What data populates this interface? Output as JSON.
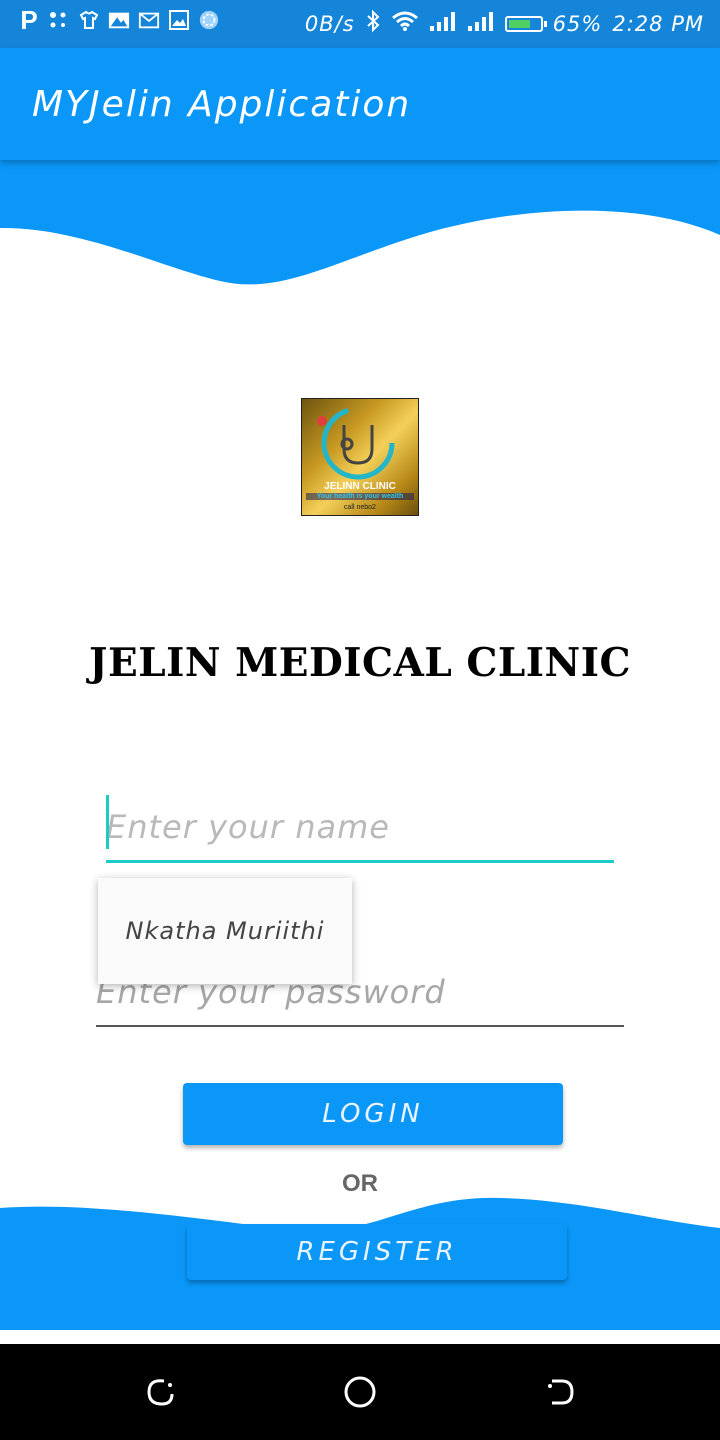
{
  "status_bar": {
    "left_icons": [
      "p-icon",
      "dots-icon",
      "tshirt-icon",
      "image-icon",
      "gmail-icon",
      "gallery-icon",
      "sync-icon"
    ],
    "net_speed": "0B/s",
    "battery_percent": "65%",
    "battery_level": 0.65,
    "time": "2:28 PM"
  },
  "app_bar": {
    "title": "MYJelin Application"
  },
  "colors": {
    "primary": "#0b97f8",
    "status_bar": "#1485d8",
    "accent": "#1ccbc6"
  },
  "logo": {
    "name": "JELINN CLINIC",
    "tagline": "Your health is your wealth",
    "call": "call nebo2"
  },
  "heading": "JELIN MEDICAL CLINIC",
  "form": {
    "name_placeholder": "Enter your name",
    "name_value": "",
    "password_placeholder": "Enter your password",
    "password_value": ""
  },
  "autocomplete": {
    "items": [
      "Nkatha Muriithi"
    ]
  },
  "buttons": {
    "login": "LOGIN",
    "or": "OR",
    "register": "REGISTER"
  }
}
